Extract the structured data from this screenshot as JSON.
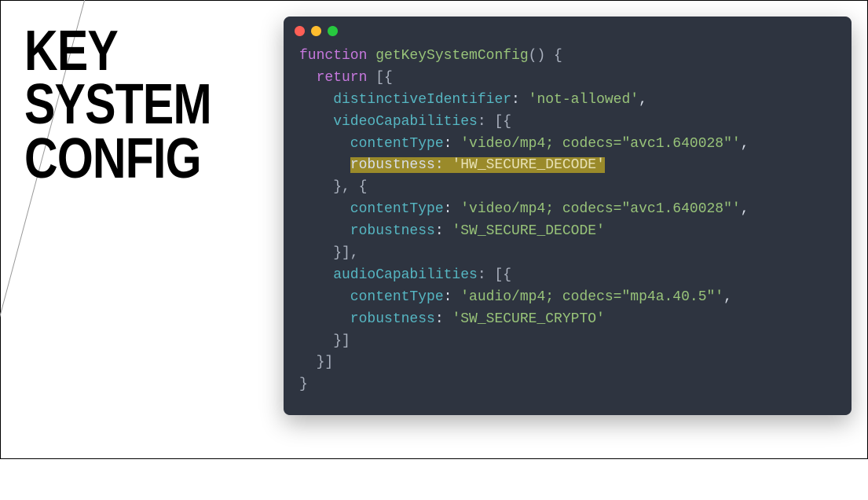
{
  "title": "KEY SYSTEM\nCONFIG",
  "code": {
    "line1_kw": "function",
    "line1_fn": " getKeySystemConfig",
    "line1_rest": "() {",
    "line2_kw": "  return",
    "line2_rest": " [{",
    "line3_key": "    distinctiveIdentifier",
    "line3_punct": ": ",
    "line3_str": "'not-allowed'",
    "line3_end": ",",
    "line4_key": "    videoCapabilities",
    "line4_rest": ": [{",
    "line5_key": "      contentType",
    "line5_punct": ": ",
    "line5_str": "'video/mp4; codecs=\"avc1.640028\"'",
    "line5_end": ",",
    "line6_pre": "      ",
    "line6_key": "robustness",
    "line6_punct": ": ",
    "line6_str": "'HW_SECURE_DECODE'",
    "line7": "    }, {",
    "line8_key": "      contentType",
    "line8_punct": ": ",
    "line8_str": "'video/mp4; codecs=\"avc1.640028\"'",
    "line8_end": ",",
    "line9_key": "      robustness",
    "line9_punct": ": ",
    "line9_str": "'SW_SECURE_DECODE'",
    "line10": "    }],",
    "line11_key": "    audioCapabilities",
    "line11_rest": ": [{",
    "line12_key": "      contentType",
    "line12_punct": ": ",
    "line12_str": "'audio/mp4; codecs=\"mp4a.40.5\"'",
    "line12_end": ",",
    "line13_key": "      robustness",
    "line13_punct": ": ",
    "line13_str": "'SW_SECURE_CRYPTO'",
    "line14": "    }]",
    "line15": "  }]",
    "line16": "}"
  }
}
